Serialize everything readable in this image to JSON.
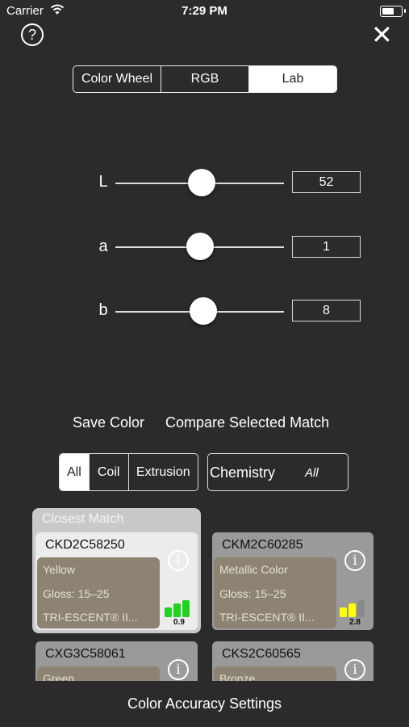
{
  "status_bar": {
    "carrier": "Carrier",
    "time": "7:29 PM"
  },
  "top": {
    "help_glyph": "?",
    "close_glyph": "✕"
  },
  "mode_tabs": [
    {
      "label": "Color Wheel",
      "active": false
    },
    {
      "label": "RGB",
      "active": false
    },
    {
      "label": "Lab",
      "active": true
    }
  ],
  "sliders": [
    {
      "label": "L",
      "value": "52",
      "fraction": 0.51
    },
    {
      "label": "a",
      "value": "1",
      "fraction": 0.5
    },
    {
      "label": "b",
      "value": "8",
      "fraction": 0.52
    }
  ],
  "actions": {
    "save": "Save Color",
    "compare": "Compare Selected Match"
  },
  "filters": [
    {
      "label": "All",
      "active": true
    },
    {
      "label": "Coil",
      "active": false
    },
    {
      "label": "Extrusion",
      "active": false
    }
  ],
  "chemistry": {
    "label": "Chemistry",
    "value": "All"
  },
  "closest_label": "Closest Match",
  "matches": [
    {
      "code": "CKD2C58250",
      "line1": "Yellow",
      "line2": "Gloss: 15–25",
      "line3": "TRI-ESCENT® II...",
      "score": "0.9",
      "bar_color": "#1fd31f",
      "bar_levels": [
        3,
        3,
        3
      ]
    },
    {
      "code": "CKM2C60285",
      "line1": "Metallic Color",
      "line2": "Gloss: 15–25",
      "line3": "TRI-ESCENT® II...",
      "score": "2.8",
      "bar_color": "#ffff00",
      "bar_levels": [
        2,
        2,
        0
      ]
    },
    {
      "code": "CXG3C58061",
      "line1": "Green",
      "line2": "",
      "line3": ""
    },
    {
      "code": "CKS2C60565",
      "line1": "Bronze",
      "line2": "",
      "line3": ""
    }
  ],
  "footer": {
    "label": "Color Accuracy Settings"
  },
  "info_glyph": "i"
}
